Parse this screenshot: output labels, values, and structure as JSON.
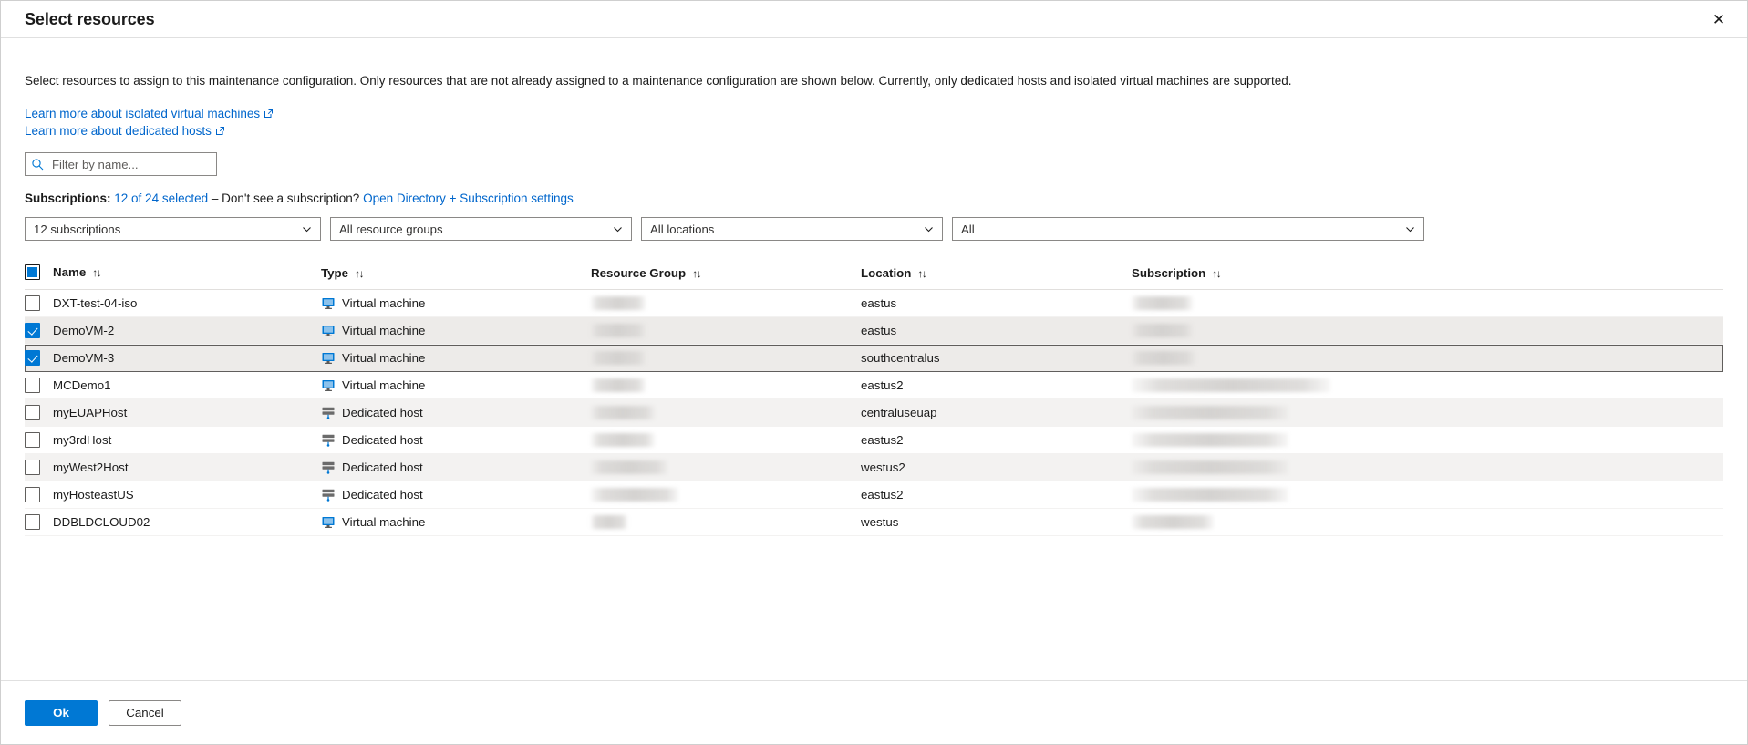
{
  "dialog": {
    "title": "Select resources",
    "close_label": "✕"
  },
  "intro": {
    "text": "Select resources to assign to this maintenance configuration. Only resources that are not already assigned to a maintenance configuration are shown below. Currently, only dedicated hosts and isolated virtual machines are supported."
  },
  "links": [
    {
      "label": "Learn more about isolated virtual machines",
      "icon": "external-link-icon"
    },
    {
      "label": "Learn more about dedicated hosts",
      "icon": "external-link-icon"
    }
  ],
  "search": {
    "placeholder": "Filter by name...",
    "value": "",
    "icon": "search-icon"
  },
  "subscriptions_line": {
    "label": "Subscriptions:",
    "selected_link": "12 of 24 selected",
    "middle_text": "– Don't see a subscription?",
    "settings_link": "Open Directory + Subscription settings"
  },
  "filters": [
    {
      "name": "subscription-filter",
      "value": "12 subscriptions"
    },
    {
      "name": "resource-group-filter",
      "value": "All resource groups"
    },
    {
      "name": "location-filter",
      "value": "All locations"
    },
    {
      "name": "type-filter",
      "value": "All"
    }
  ],
  "table": {
    "select_all_state": "indeterminate",
    "sort_glyph": "↑↓",
    "columns": [
      {
        "key": "name",
        "label": "Name"
      },
      {
        "key": "type",
        "label": "Type"
      },
      {
        "key": "resource_group",
        "label": "Resource Group"
      },
      {
        "key": "location",
        "label": "Location"
      },
      {
        "key": "subscription",
        "label": "Subscription"
      }
    ],
    "rows": [
      {
        "name": "DXT-test-04-iso",
        "type": "Virtual machine",
        "type_icon": "virtual-machine-icon",
        "location": "eastus",
        "checked": false,
        "rg_redacted_width": 60,
        "sub_redacted_width": 67,
        "row_style": "plain"
      },
      {
        "name": "DemoVM-2",
        "type": "Virtual machine",
        "type_icon": "virtual-machine-icon",
        "location": "eastus",
        "checked": true,
        "rg_redacted_width": 60,
        "sub_redacted_width": 67,
        "row_style": "selected"
      },
      {
        "name": "DemoVM-3",
        "type": "Virtual machine",
        "type_icon": "virtual-machine-icon",
        "location": "southcentralus",
        "checked": true,
        "rg_redacted_width": 60,
        "sub_redacted_width": 70,
        "row_style": "focused"
      },
      {
        "name": "MCDemo1",
        "type": "Virtual machine",
        "type_icon": "virtual-machine-icon",
        "location": "eastus2",
        "checked": false,
        "rg_redacted_width": 60,
        "sub_redacted_width": 218,
        "row_style": "plain"
      },
      {
        "name": "myEUAPHost",
        "type": "Dedicated host",
        "type_icon": "dedicated-host-icon",
        "location": "centraluseuap",
        "checked": false,
        "rg_redacted_width": 70,
        "sub_redacted_width": 172,
        "row_style": "alt"
      },
      {
        "name": "my3rdHost",
        "type": "Dedicated host",
        "type_icon": "dedicated-host-icon",
        "location": "eastus2",
        "checked": false,
        "rg_redacted_width": 70,
        "sub_redacted_width": 172,
        "row_style": "plain"
      },
      {
        "name": "myWest2Host",
        "type": "Dedicated host",
        "type_icon": "dedicated-host-icon",
        "location": "westus2",
        "checked": false,
        "rg_redacted_width": 84,
        "sub_redacted_width": 172,
        "row_style": "alt"
      },
      {
        "name": "myHosteastUS",
        "type": "Dedicated host",
        "type_icon": "dedicated-host-icon",
        "location": "eastus2",
        "checked": false,
        "rg_redacted_width": 96,
        "sub_redacted_width": 172,
        "row_style": "plain"
      },
      {
        "name": "DDBLDCLOUD02",
        "type": "Virtual machine",
        "type_icon": "virtual-machine-icon",
        "location": "westus",
        "checked": false,
        "rg_redacted_width": 40,
        "sub_redacted_width": 90,
        "row_style": "plain"
      }
    ]
  },
  "footer": {
    "ok_label": "Ok",
    "cancel_label": "Cancel"
  },
  "colors": {
    "accent": "#0078d4",
    "link": "#0066cc",
    "row_alt": "#f3f2f1",
    "row_selected": "#edebe9",
    "text": "#1b1b1b"
  }
}
